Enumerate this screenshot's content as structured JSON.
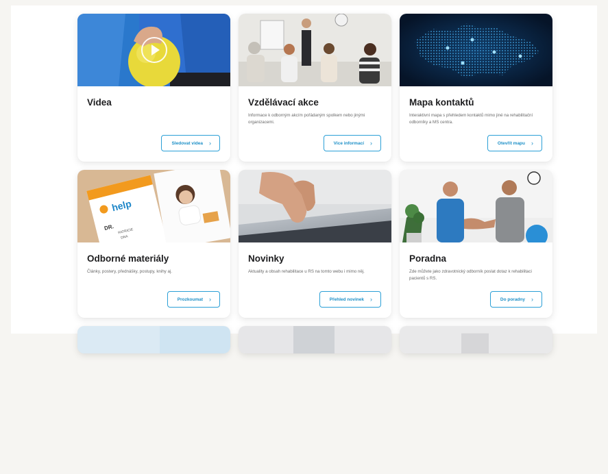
{
  "cards": [
    {
      "title": "Videa",
      "desc": "",
      "button": "Sledovat videa",
      "image_icon": "play-icon"
    },
    {
      "title": "Vzdělávací akce",
      "desc": "Informace k odborným akcím pořádaným spolkem nebo jinými organizacemi.",
      "button": "Více informací"
    },
    {
      "title": "Mapa kontaktů",
      "desc": "Interaktivní mapa s přehledem kontaktů mimo jiné na rehabilitační odborníky a MS centra.",
      "button": "Otevřít mapu"
    },
    {
      "title": "Odborné materiály",
      "desc": "Články, postery, přednášky, postupy, knihy aj.",
      "button": "Prozkoumat",
      "image_text": [
        "help",
        "DR.",
        "PATRICIE",
        "DNA"
      ]
    },
    {
      "title": "Novinky",
      "desc": "Aktuality a obsah rehabilitace u RS na tomto webu i mimo něj.",
      "button": "Přehled novinek"
    },
    {
      "title": "Poradna",
      "desc": "Zde můžete jako zdravotnický odborník poslat dotaz k rehabilitaci pacientů s RS.",
      "button": "Do poradny"
    }
  ],
  "colors": {
    "accent": "#1c8fc7",
    "title": "#1d1d1f",
    "text": "#6a6a6a"
  }
}
